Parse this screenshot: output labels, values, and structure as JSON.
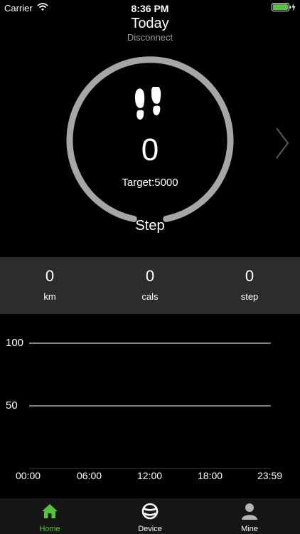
{
  "status_bar": {
    "carrier": "Carrier",
    "time": "8:36 PM"
  },
  "header": {
    "title": "Today",
    "subtitle": "Disconnect"
  },
  "ring": {
    "steps": "0",
    "target": "Target:5000",
    "label": "Step"
  },
  "stats": [
    {
      "value": "0",
      "label": "km"
    },
    {
      "value": "0",
      "label": "cals"
    },
    {
      "value": "0",
      "label": "step"
    }
  ],
  "chart_data": {
    "type": "bar",
    "categories": [
      "00:00",
      "06:00",
      "12:00",
      "18:00",
      "23:59"
    ],
    "values": [],
    "y_ticks": [
      "100",
      "50"
    ],
    "ylim": [
      0,
      100
    ],
    "grid": true
  },
  "tabs": [
    {
      "label": "Home",
      "icon": "home-icon",
      "active": true
    },
    {
      "label": "Device",
      "icon": "band-icon"
    },
    {
      "label": "Mine",
      "icon": "person-icon"
    }
  ],
  "colors": {
    "accent": "#58c43b",
    "ring": "#a6a6a6",
    "band": "#2b2c2d"
  }
}
